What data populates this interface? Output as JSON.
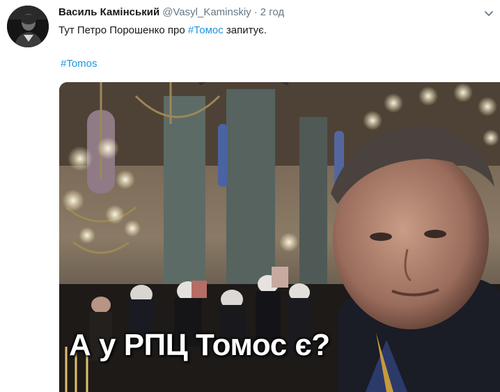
{
  "tweet": {
    "author_name": "Василь Камінський",
    "author_handle": "@Vasyl_Kaminskiy",
    "separator": "·",
    "timestamp": "2 год",
    "text_before": "Тут Петро Порошенко про ",
    "text_hashtag": "#Томос",
    "text_after": " запитує.",
    "hashtag_line": "#Tomos"
  },
  "media": {
    "caption": "А у РПЦ Томос є?"
  },
  "icons": {
    "avatar": "user-avatar",
    "menu": "chevron-down-icon"
  },
  "colors": {
    "link": "#1b95e0",
    "secondary_text": "#657786",
    "primary_text": "#14171a"
  }
}
